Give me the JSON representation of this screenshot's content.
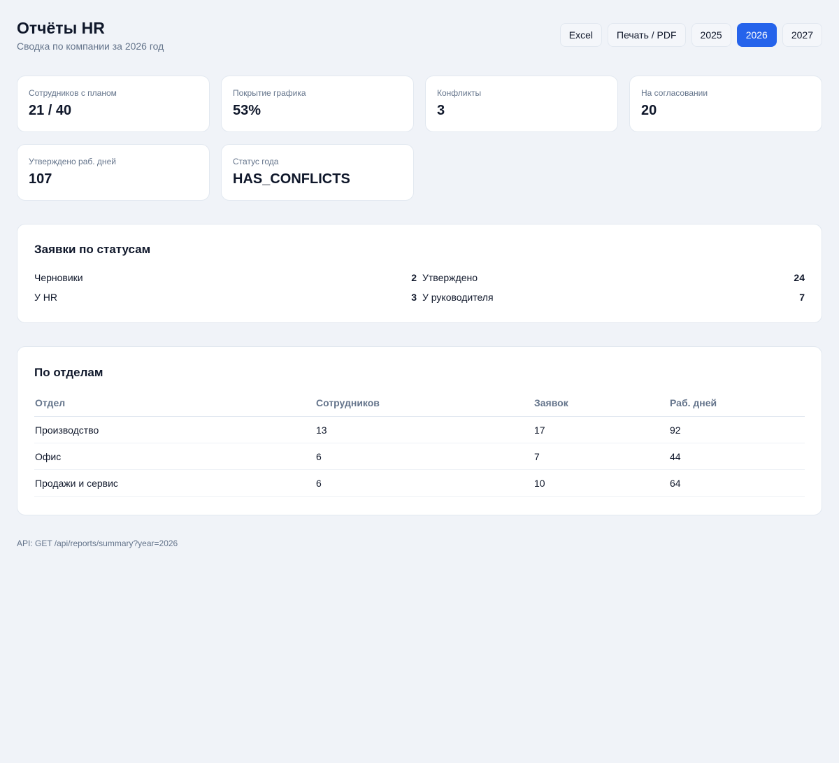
{
  "header": {
    "title": "Отчёты HR",
    "subtitle": "Сводка по компании за 2026 год"
  },
  "toolbar": {
    "excel_label": "Excel",
    "print_label": "Печать / PDF",
    "years": [
      "2025",
      "2026",
      "2027"
    ],
    "selected_year": "2026"
  },
  "colors": {
    "accent": "#2563eb",
    "background": "#f0f3f8",
    "muted_text": "#64748b"
  },
  "kpis": [
    {
      "label": "Сотрудников с планом",
      "value": "21 / 40"
    },
    {
      "label": "Покрытие графика",
      "value": "53%"
    },
    {
      "label": "Конфликты",
      "value": "3"
    },
    {
      "label": "На согласовании",
      "value": "20"
    },
    {
      "label": "Утверждено раб. дней",
      "value": "107"
    },
    {
      "label": "Статус года",
      "value": "HAS_CONFLICTS"
    }
  ],
  "status_section": {
    "title": "Заявки по статусам",
    "items": [
      {
        "label": "Черновики",
        "value": "2"
      },
      {
        "label": "Утверждено",
        "value": "24"
      },
      {
        "label": "У HR",
        "value": "3"
      },
      {
        "label": "У руководителя",
        "value": "7"
      }
    ]
  },
  "departments": {
    "title": "По отделам",
    "columns": [
      "Отдел",
      "Сотрудников",
      "Заявок",
      "Раб. дней"
    ],
    "rows": [
      [
        "Производство",
        "13",
        "17",
        "92"
      ],
      [
        "Офис",
        "6",
        "7",
        "44"
      ],
      [
        "Продажи и сервис",
        "6",
        "10",
        "64"
      ]
    ]
  },
  "footer": {
    "api_text": "API: GET /api/reports/summary?year=2026"
  }
}
